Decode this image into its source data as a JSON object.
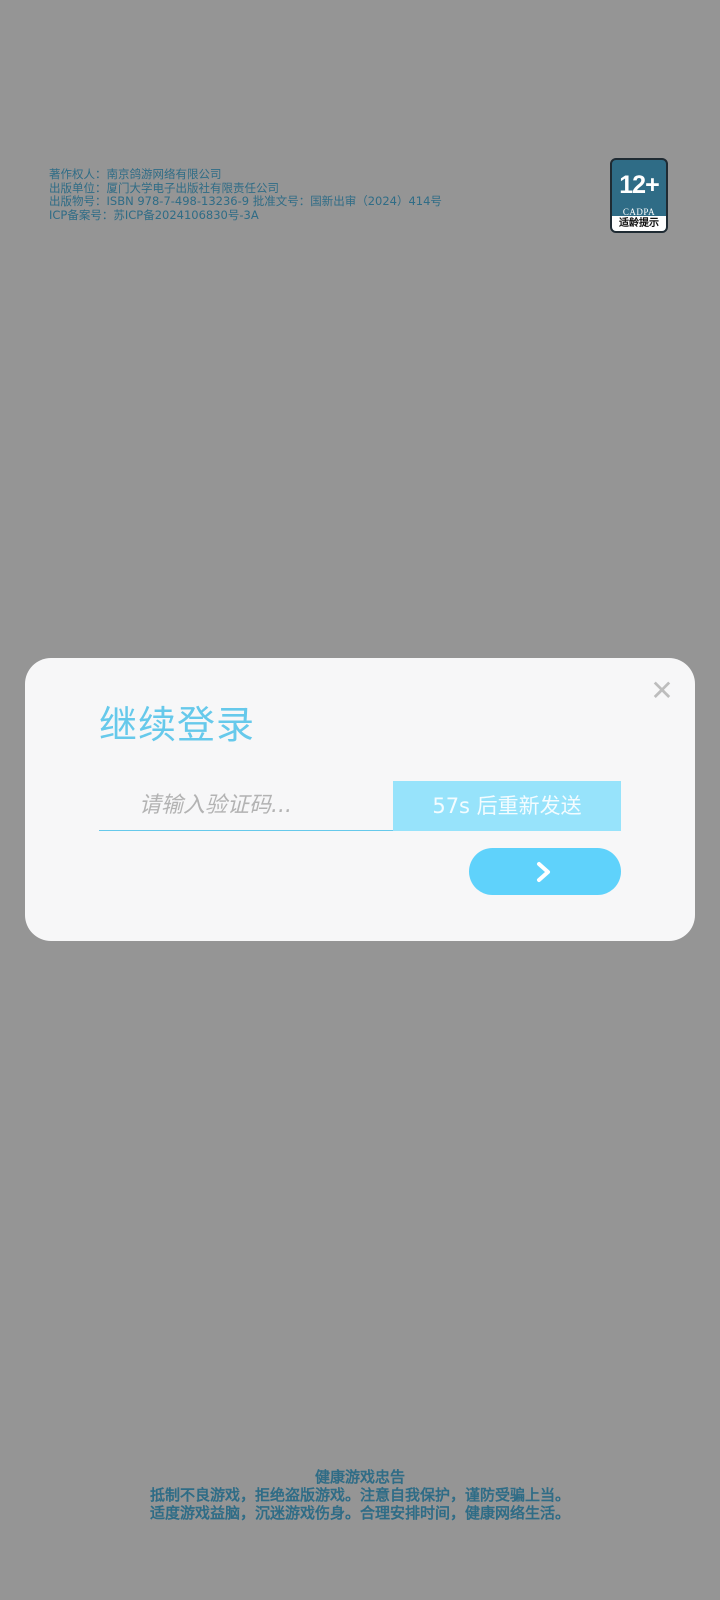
{
  "publication_info": {
    "lines": [
      "著作权人：南京鸽游网络有限公司",
      "出版单位：厦门大学电子出版社有限责任公司",
      "出版物号：ISBN 978-7-498-13236-9 批准文号：国新出审（2024）414号",
      "ICP备案号：苏ICP备2024106830号-3A"
    ]
  },
  "age_badge": {
    "rating": "12+",
    "org": "CADPA",
    "caption": "适龄提示"
  },
  "dialog": {
    "title": "继续登录",
    "code_input": {
      "value": "",
      "placeholder": "请输入验证码..."
    },
    "resend_label": "57s 后重新发送",
    "submit_icon": "chevron-right-icon",
    "close_icon": "close-icon"
  },
  "health_notice": {
    "title": "健康游戏忠告",
    "lines": [
      "抵制不良游戏，拒绝盗版游戏。注意自我保护，谨防受骗上当。",
      "适度游戏益脑，沉迷游戏伤身。合理安排时间，健康网络生活。"
    ]
  },
  "colors": {
    "overlay": "#959595",
    "accent": "#66c9eb",
    "resend_bg": "#97e3fb",
    "submit_bg": "#5fd2fb",
    "info_text": "#2f6c86",
    "dialog_bg": "#f7f7f8"
  }
}
